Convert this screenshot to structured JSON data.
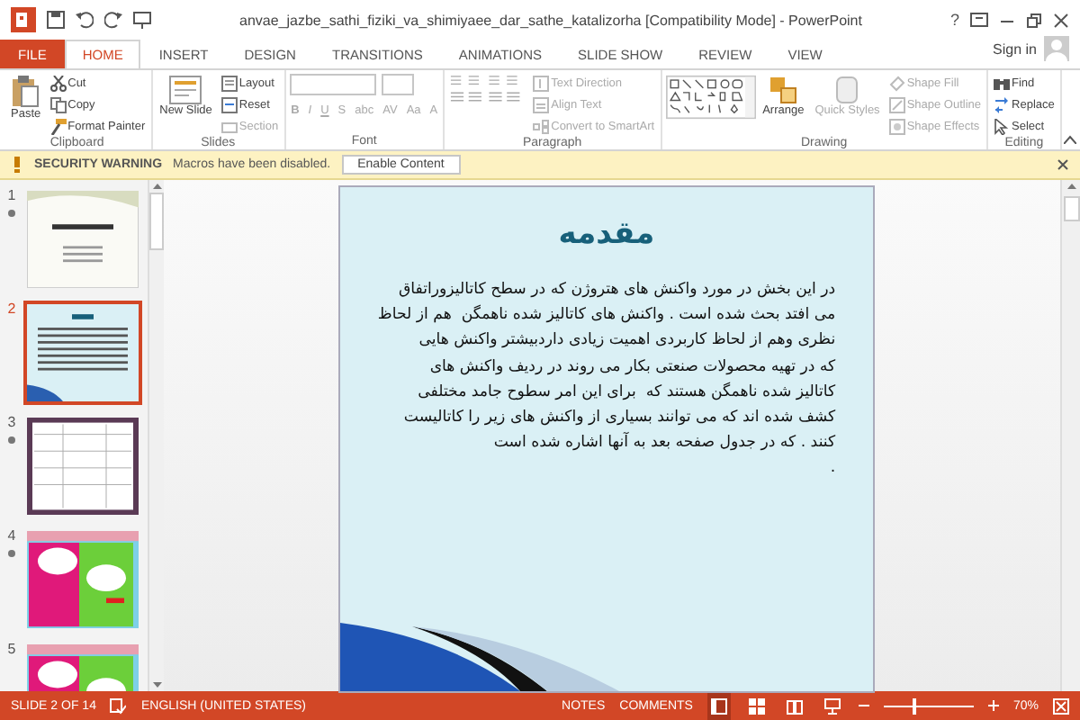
{
  "window": {
    "title": "anvae_jazbe_sathi_fiziki_va_shimiyaee_dar_sathe_katalizorha [Compatibility Mode] - PowerPoint",
    "help": "?"
  },
  "tabs": [
    {
      "label": "FILE",
      "kind": "file",
      "selected": false
    },
    {
      "label": "HOME",
      "kind": "tab",
      "selected": true
    },
    {
      "label": "INSERT",
      "kind": "tab",
      "selected": false
    },
    {
      "label": "DESIGN",
      "kind": "tab",
      "selected": false
    },
    {
      "label": "TRANSITIONS",
      "kind": "tab",
      "selected": false
    },
    {
      "label": "ANIMATIONS",
      "kind": "tab",
      "selected": false
    },
    {
      "label": "SLIDE SHOW",
      "kind": "tab",
      "selected": false
    },
    {
      "label": "REVIEW",
      "kind": "tab",
      "selected": false
    },
    {
      "label": "VIEW",
      "kind": "tab",
      "selected": false
    }
  ],
  "account": {
    "label": "Sign in"
  },
  "ribbon": {
    "groups": [
      {
        "label": "Clipboard",
        "kind": "clipboard",
        "items": [
          {
            "label": "Paste",
            "kind": "large",
            "disabled": false
          },
          {
            "label": "Cut",
            "kind": "small",
            "disabled": false
          },
          {
            "label": "Copy",
            "kind": "small",
            "disabled": false
          },
          {
            "label": "Format Painter",
            "kind": "small",
            "disabled": false
          }
        ]
      },
      {
        "label": "Slides",
        "kind": "slides",
        "items": [
          {
            "label": "New Slide",
            "kind": "large",
            "disabled": false
          },
          {
            "label": "Layout",
            "kind": "small",
            "disabled": false
          },
          {
            "label": "Reset",
            "kind": "small",
            "disabled": false
          },
          {
            "label": "Section",
            "kind": "small",
            "disabled": true
          }
        ]
      },
      {
        "label": "Font",
        "kind": "font",
        "items": [
          {
            "label": "B",
            "kind": "glyph",
            "disabled": true
          },
          {
            "label": "I",
            "kind": "glyph",
            "disabled": true
          },
          {
            "label": "U",
            "kind": "glyph",
            "disabled": true
          },
          {
            "label": "S",
            "kind": "glyph",
            "disabled": true
          },
          {
            "label": "abc",
            "kind": "glyph",
            "disabled": true
          },
          {
            "label": "AV",
            "kind": "glyph",
            "disabled": true
          },
          {
            "label": "Aa",
            "kind": "glyph",
            "disabled": true
          },
          {
            "label": "A",
            "kind": "glyph",
            "disabled": true
          }
        ]
      },
      {
        "label": "Paragraph",
        "kind": "paragraph",
        "items": [
          {
            "label": "Text Direction",
            "kind": "small",
            "disabled": true
          },
          {
            "label": "Align Text",
            "kind": "small",
            "disabled": true
          },
          {
            "label": "Convert to SmartArt",
            "kind": "small",
            "disabled": true
          }
        ]
      },
      {
        "label": "Drawing",
        "kind": "drawing",
        "items": [
          {
            "label": "Arrange",
            "kind": "large",
            "disabled": false
          },
          {
            "label": "Quick Styles",
            "kind": "large",
            "disabled": true
          },
          {
            "label": "Shape Fill",
            "kind": "small",
            "disabled": true
          },
          {
            "label": "Shape Outline",
            "kind": "small",
            "disabled": true
          },
          {
            "label": "Shape Effects",
            "kind": "small",
            "disabled": true
          }
        ]
      },
      {
        "label": "Editing",
        "kind": "editing",
        "items": [
          {
            "label": "Find",
            "kind": "small",
            "disabled": false
          },
          {
            "label": "Replace",
            "kind": "small",
            "disabled": false
          },
          {
            "label": "Select",
            "kind": "small",
            "disabled": false
          }
        ]
      }
    ]
  },
  "security_bar": {
    "title": "SECURITY WARNING",
    "message": "Macros have been disabled.",
    "button": "Enable Content"
  },
  "thumbnails": [
    {
      "number": "1",
      "kind": "title",
      "animated": true,
      "selected": false
    },
    {
      "number": "2",
      "kind": "text",
      "animated": false,
      "selected": true
    },
    {
      "number": "3",
      "kind": "table",
      "animated": true,
      "selected": false
    },
    {
      "number": "4",
      "kind": "colorful",
      "animated": true,
      "selected": false
    },
    {
      "number": "5",
      "kind": "colorful",
      "animated": false,
      "selected": false
    }
  ],
  "slide": {
    "title": "مقدمه",
    "body": "در این بخش در مورد واکنش های هتروژن که در سطح کاتالیزوراتفاق\nمی افتد بحث شده است . واکنش های کاتالیز شده ناهمگن  هم از لحاظ\nنظری وهم از لحاظ کاربردی اهمیت زیادی داردبیشتر واکنش هایی\nکه در تهیه محصولات صنعتی بکار می روند در ردیف واکنش های\nکاتالیز شده ناهمگن هستند که  برای این امر سطوح جامد مختلفی\nکشف شده اند که می توانند بسیاری از واکنش های زیر را کاتالیست\nکنند . که در جدول صفحه بعد به آنها اشاره شده است\n."
  },
  "status_bar": {
    "slide_info": "SLIDE 2 OF 14",
    "language": "ENGLISH (UNITED STATES)",
    "notes": "NOTES",
    "comments": "COMMENTS",
    "views": [
      {
        "kind": "normal",
        "selected": true
      },
      {
        "kind": "sorter",
        "selected": false
      },
      {
        "kind": "reading",
        "selected": false
      },
      {
        "kind": "show",
        "selected": false
      }
    ],
    "zoom": {
      "level": 0.35,
      "reading": "70%"
    }
  }
}
